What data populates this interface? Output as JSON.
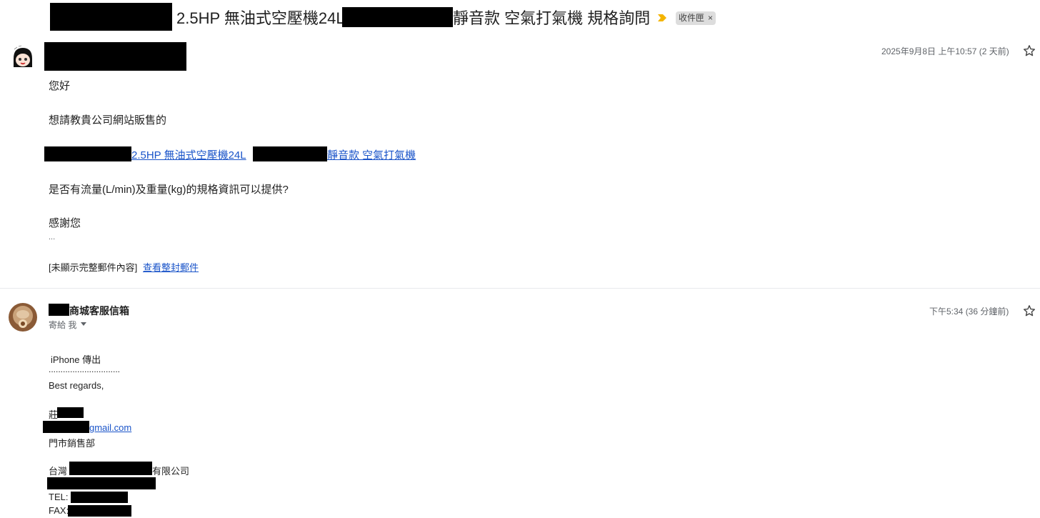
{
  "thread": {
    "subject_part1": "2.5HP 無油式空壓機24L",
    "subject_part2": "靜音款 空氣打氣機 規格詢問",
    "label": "收件匣",
    "label_close": "×"
  },
  "message1": {
    "timestamp": "2025年9月8日 上午10:57 (2 天前)",
    "greeting": "您好",
    "line1": "想請教貴公司網站販售的",
    "product_link_part1": " 2.5HP 無油式空壓機24L",
    "product_link_part2": "靜音款 空氣打氣機",
    "question": "是否有流量(L/min)及重量(kg)的規格資訊可以提供?",
    "thanks": "感謝您",
    "ellipsis": "...",
    "clipped_notice": "[未顯示完整郵件內容]",
    "view_full_link": "查看整封郵件"
  },
  "message2": {
    "sender": "商城客服信箱",
    "to_me": "寄給 我",
    "timestamp": "下午5:34 (36 分鐘前)",
    "sent_from": "iPhone 傳出",
    "dots": "..............................",
    "best_regards": "Best regards,",
    "name_prefix": "莊",
    "email_suffix": "gmail.com",
    "department": "門市銷售部",
    "company_prefix": "台灣",
    "company_suffix": "有限公司",
    "tel_label": "TEL:",
    "fax_label": "FAX:"
  },
  "colors": {
    "link": "#1a54c9",
    "importance_marker": "#f4b400",
    "label_bg": "#dddddd"
  },
  "icons": [
    "importance-marker-icon",
    "star-icon",
    "caret-down-icon",
    "label-close-icon"
  ]
}
